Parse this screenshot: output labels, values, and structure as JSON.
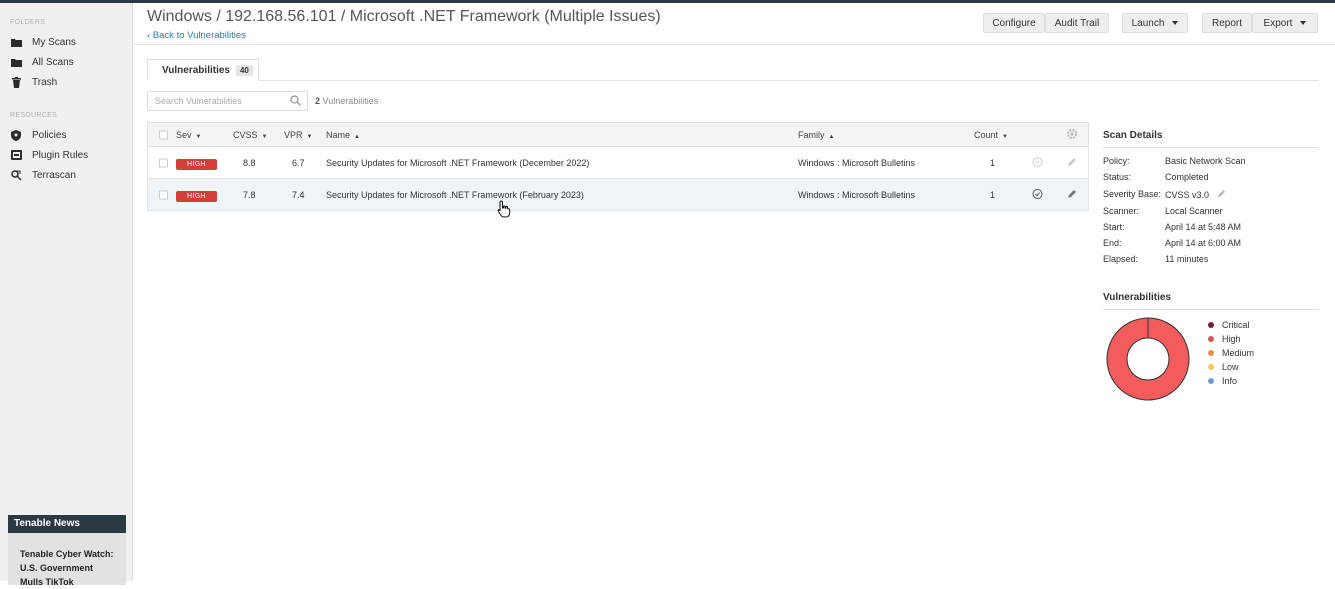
{
  "sidebar": {
    "folders_label": "FOLDERS",
    "folders": [
      "My Scans",
      "All Scans",
      "Trash"
    ],
    "resources_label": "RESOURCES",
    "resources": [
      "Policies",
      "Plugin Rules",
      "Terrascan"
    ],
    "news_title": "Tenable News",
    "news_text": "Tenable Cyber Watch: U.S. Government Mulls TikTok"
  },
  "header": {
    "title": "Windows / 192.168.56.101 / Microsoft .NET Framework (Multiple Issues)",
    "back_link": "Back to Vulnerabilities",
    "buttons": {
      "configure": "Configure",
      "audit_trail": "Audit Trail",
      "launch": "Launch",
      "report": "Report",
      "export": "Export"
    }
  },
  "tab": {
    "label": "Vulnerabilities",
    "count": "40"
  },
  "search": {
    "placeholder": "Search Vulnerabilities",
    "result_count": "2",
    "result_label": "Vulnerabilities"
  },
  "table": {
    "columns": {
      "sev": "Sev",
      "cvss": "CVSS",
      "vpr": "VPR",
      "name": "Name",
      "family": "Family",
      "count": "Count"
    },
    "rows": [
      {
        "sev": "HIGH",
        "cvss": "8.8",
        "vpr": "6.7",
        "name": "Security Updates for Microsoft .NET Framework (December 2022)",
        "family": "Windows : Microsoft Bulletins",
        "count": "1"
      },
      {
        "sev": "HIGH",
        "cvss": "7.8",
        "vpr": "7.4",
        "name": "Security Updates for Microsoft .NET Framework (February 2023)",
        "family": "Windows : Microsoft Bulletins",
        "count": "1"
      }
    ]
  },
  "scan_details": {
    "title": "Scan Details",
    "items": [
      {
        "label": "Policy:",
        "value": "Basic Network Scan"
      },
      {
        "label": "Status:",
        "value": "Completed"
      },
      {
        "label": "Severity Base:",
        "value": "CVSS v3.0"
      },
      {
        "label": "Scanner:",
        "value": "Local Scanner"
      },
      {
        "label": "Start:",
        "value": "April 14 at 5:48 AM"
      },
      {
        "label": "End:",
        "value": "April 14 at 6:00 AM"
      },
      {
        "label": "Elapsed:",
        "value": "11 minutes"
      }
    ]
  },
  "vuln_chart": {
    "title": "Vulnerabilities",
    "legend": [
      {
        "label": "Critical",
        "color": "#7a1f2b"
      },
      {
        "label": "High",
        "color": "#d4555a"
      },
      {
        "label": "Medium",
        "color": "#e8904a"
      },
      {
        "label": "Low",
        "color": "#f2c94c"
      },
      {
        "label": "Info",
        "color": "#6fa1c8"
      }
    ],
    "high_color": "#f25c5c"
  }
}
